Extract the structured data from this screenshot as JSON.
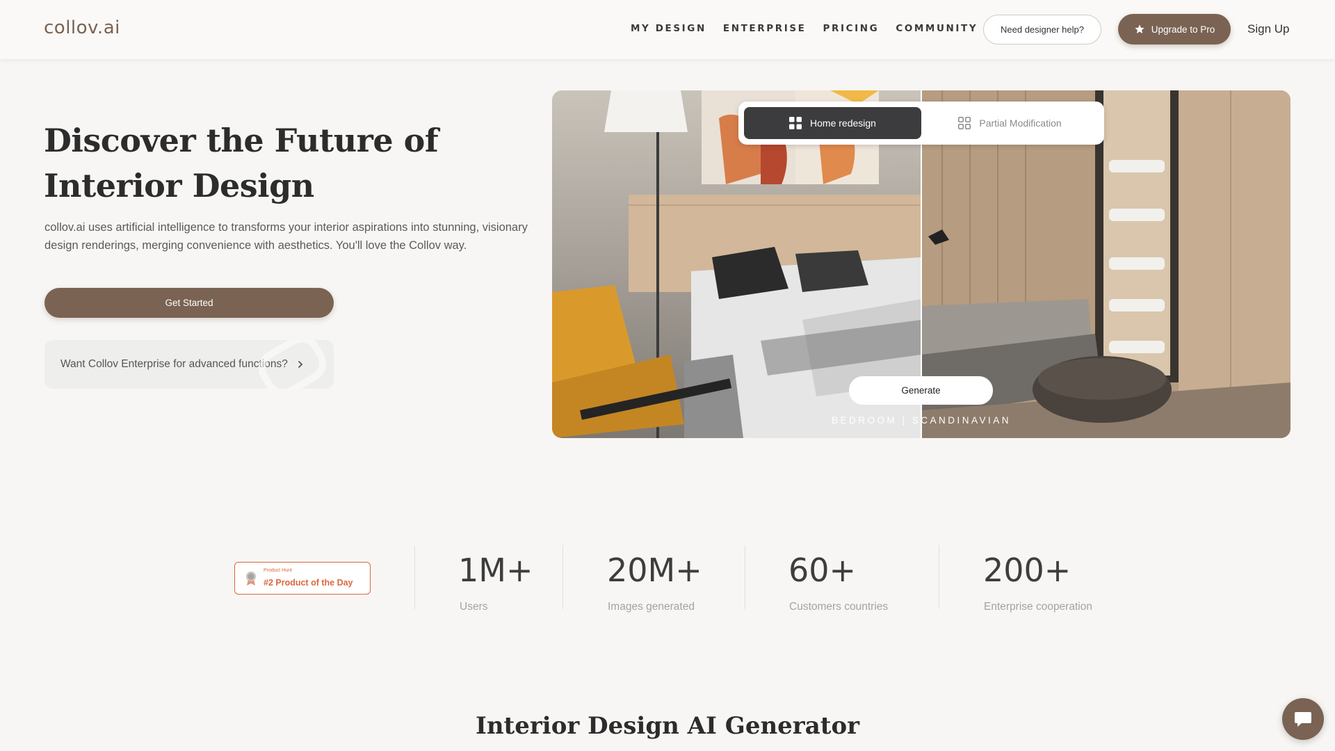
{
  "brand": {
    "logo_text": "collov.ai",
    "accent_color": "#7a6353"
  },
  "nav": {
    "items": [
      {
        "label": "MY DESIGN"
      },
      {
        "label": "ENTERPRISE"
      },
      {
        "label": "PRICING"
      },
      {
        "label": "COMMUNITY"
      }
    ],
    "designer_help_label": "Need designer help?",
    "upgrade_label": "Upgrade to Pro",
    "signup_label": "Sign Up"
  },
  "hero": {
    "title": "Discover the Future of Interior Design",
    "description": "collov.ai uses artificial intelligence to transforms your interior aspirations into stunning, visionary design renderings, merging convenience with aesthetics. You'll love the Collov way.",
    "cta_label": "Get Started",
    "enterprise_prompt": "Want Collov Enterprise for advanced functions?"
  },
  "preview": {
    "tabs": [
      {
        "label": "Home redesign",
        "active": true
      },
      {
        "label": "Partial Modification",
        "active": false
      }
    ],
    "generate_label": "Generate",
    "caption": "BEDROOM | SCANDINAVIAN"
  },
  "badge": {
    "small_text": "Product Hunt",
    "main_text": "#2 Product of the Day",
    "color": "#d9683e"
  },
  "stats": [
    {
      "value": "1M+",
      "label": "Users"
    },
    {
      "value": "20M+",
      "label": "Images generated"
    },
    {
      "value": "60+",
      "label": "Customers countries"
    },
    {
      "value": "200+",
      "label": "Enterprise cooperation"
    }
  ],
  "section": {
    "title": "Interior Design AI Generator"
  }
}
